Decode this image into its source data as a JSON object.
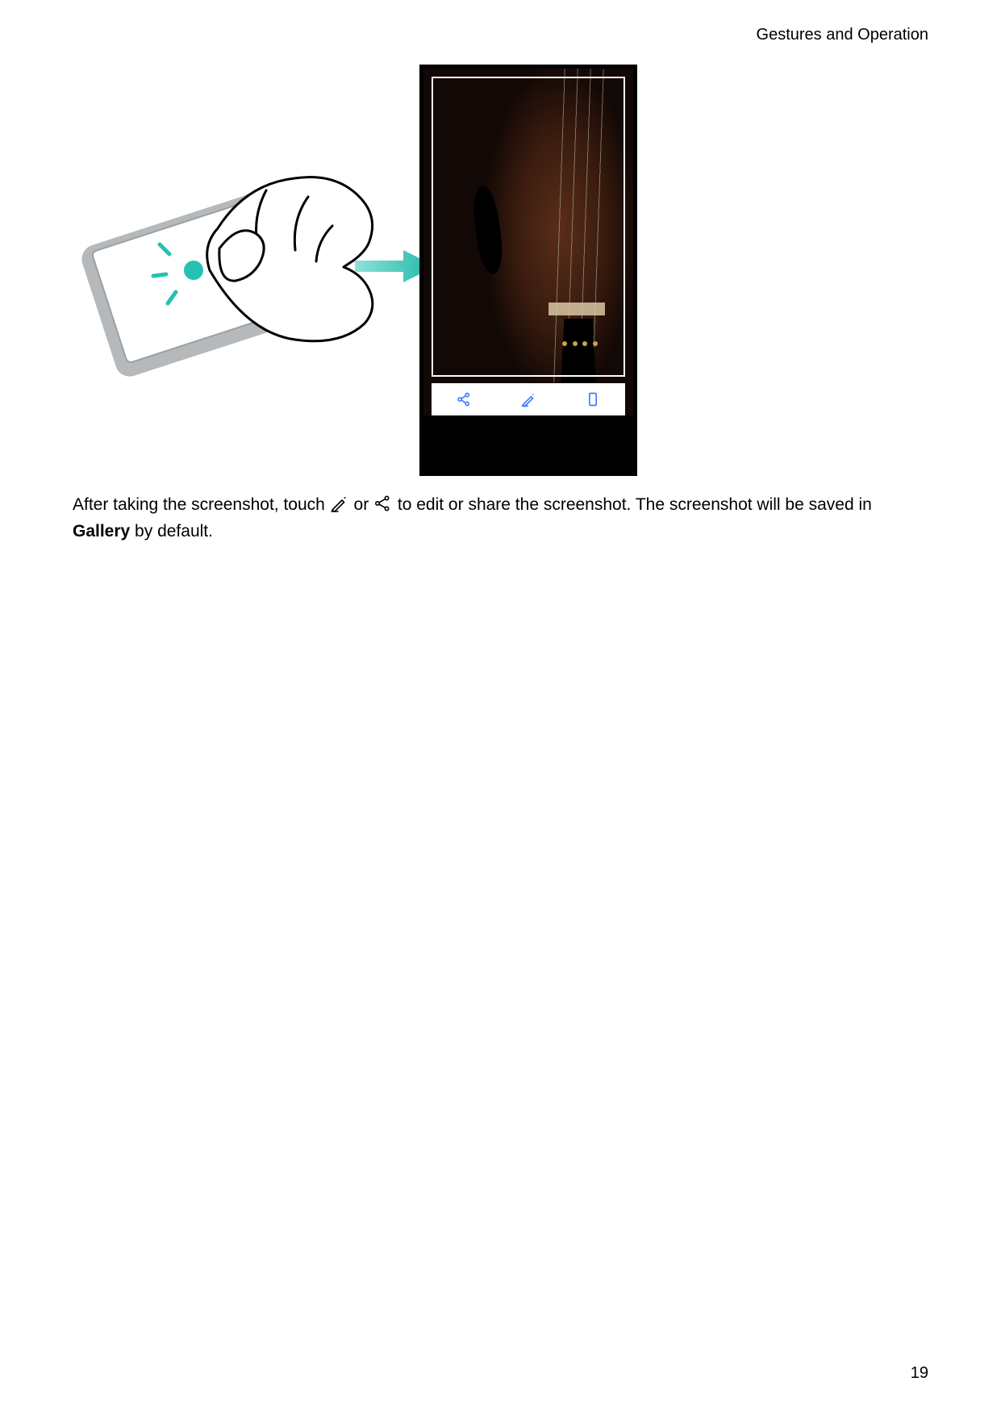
{
  "header": {
    "section_title": "Gestures and Operation"
  },
  "footer": {
    "page_number": "19"
  },
  "body": {
    "text_1": "After taking the screenshot, touch ",
    "text_or": " or ",
    "text_2": " to edit or share the screenshot. The screenshot will be saved in ",
    "gallery_label": "Gallery",
    "text_3": " by default."
  },
  "icons": {
    "edit_icon_name": "edit-icon",
    "share_icon_name": "share-icon",
    "crop_icon_name": "scroll-icon"
  },
  "illustration": {
    "gesture_desc": "knuckle-tap-gesture",
    "arrow_desc": "right-arrow",
    "phone_subject": "violin"
  }
}
